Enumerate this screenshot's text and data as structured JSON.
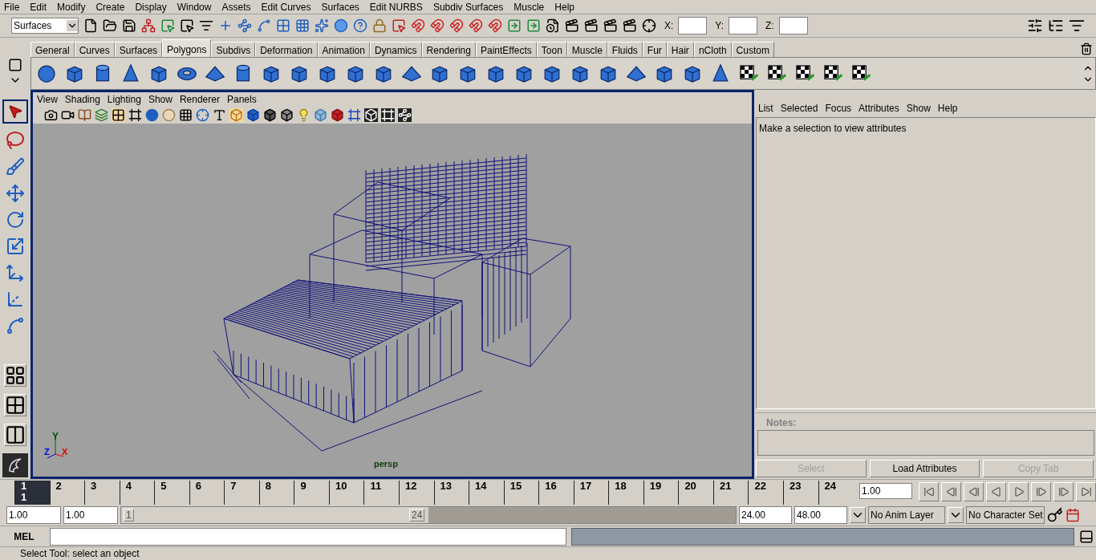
{
  "menu_bar": [
    "File",
    "Edit",
    "Modify",
    "Create",
    "Display",
    "Window",
    "Assets",
    "Edit Curves",
    "Surfaces",
    "Edit NURBS",
    "Subdiv Surfaces",
    "Muscle",
    "Help"
  ],
  "status_line": {
    "menu_set": "Surfaces",
    "coord_labels": [
      "X:",
      "Y:",
      "Z:"
    ]
  },
  "shelf": {
    "tabs": [
      {
        "label": "General",
        "selected": false
      },
      {
        "label": "Curves",
        "selected": false
      },
      {
        "label": "Surfaces",
        "selected": false
      },
      {
        "label": "Polygons",
        "selected": true
      },
      {
        "label": "Subdivs",
        "selected": false
      },
      {
        "label": "Deformation",
        "selected": false
      },
      {
        "label": "Animation",
        "selected": false
      },
      {
        "label": "Dynamics",
        "selected": false
      },
      {
        "label": "Rendering",
        "selected": false
      },
      {
        "label": "PaintEffects",
        "selected": false
      },
      {
        "label": "Toon",
        "selected": false
      },
      {
        "label": "Muscle",
        "selected": false
      },
      {
        "label": "Fluids",
        "selected": false
      },
      {
        "label": "Fur",
        "selected": false
      },
      {
        "label": "Hair",
        "selected": false
      },
      {
        "label": "nCloth",
        "selected": false
      },
      {
        "label": "Custom",
        "selected": false
      }
    ]
  },
  "viewport": {
    "menu": [
      "View",
      "Shading",
      "Lighting",
      "Show",
      "Renderer",
      "Panels"
    ],
    "camera": "persp",
    "axis_labels": [
      "Y",
      "Z",
      "X"
    ]
  },
  "attribute_editor": {
    "menu": [
      "List",
      "Selected",
      "Focus",
      "Attributes",
      "Show",
      "Help"
    ],
    "message": "Make a selection to view attributes",
    "notes_label": "Notes:",
    "buttons": [
      {
        "label": "Select",
        "disabled": true
      },
      {
        "label": "Load Attributes",
        "disabled": false
      },
      {
        "label": "Copy Tab",
        "disabled": true
      }
    ]
  },
  "time_slider": {
    "frames": [
      {
        "label": "1",
        "selected": true
      },
      {
        "label": "2",
        "selected": false
      },
      {
        "label": "3",
        "selected": false
      },
      {
        "label": "4",
        "selected": false
      },
      {
        "label": "5",
        "selected": false
      },
      {
        "label": "6",
        "selected": false
      },
      {
        "label": "7",
        "selected": false
      },
      {
        "label": "8",
        "selected": false
      },
      {
        "label": "9",
        "selected": false
      },
      {
        "label": "10",
        "selected": false
      },
      {
        "label": "11",
        "selected": false
      },
      {
        "label": "12",
        "selected": false
      },
      {
        "label": "13",
        "selected": false
      },
      {
        "label": "14",
        "selected": false
      },
      {
        "label": "15",
        "selected": false
      },
      {
        "label": "16",
        "selected": false
      },
      {
        "label": "17",
        "selected": false
      },
      {
        "label": "18",
        "selected": false
      },
      {
        "label": "19",
        "selected": false
      },
      {
        "label": "20",
        "selected": false
      },
      {
        "label": "21",
        "selected": false
      },
      {
        "label": "22",
        "selected": false
      },
      {
        "label": "23",
        "selected": false
      },
      {
        "label": "24",
        "selected": false
      }
    ],
    "current_frame": "1",
    "current_time": "1.00"
  },
  "range_slider": {
    "start_time": "1.00",
    "playback_start": "1.00",
    "handle_start": "1",
    "handle_end": "24",
    "level": 0.5,
    "playback_end": "24.00",
    "end_time": "48.00",
    "anim_layer": "No Anim Layer",
    "character_set": "No Character Set"
  },
  "command_line": {
    "label": "MEL"
  },
  "help_line": {
    "text": "Select Tool: select an object"
  }
}
